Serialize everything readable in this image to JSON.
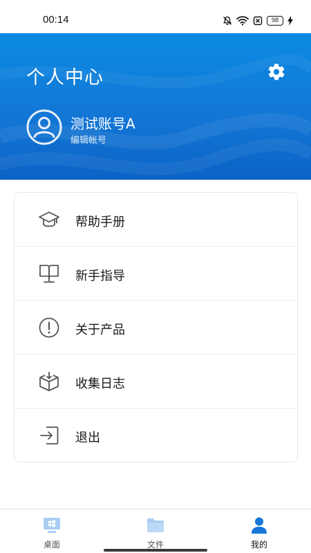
{
  "status_bar": {
    "time": "00:14",
    "battery": "98",
    "icons": [
      "mute-icon",
      "wifi-icon",
      "no-sim-icon",
      "battery-icon",
      "charging-icon"
    ]
  },
  "header": {
    "title": "个人中心",
    "settings_icon": "gear-icon",
    "account": {
      "avatar_icon": "user-avatar-icon",
      "name": "测试账号A",
      "edit_label": "编辑帐号"
    },
    "background_color": "#0b7ad8"
  },
  "menu": {
    "items": [
      {
        "label": "帮助手册",
        "icon": "graduation-cap-icon"
      },
      {
        "label": "新手指导",
        "icon": "open-book-monitor-icon"
      },
      {
        "label": "关于产品",
        "icon": "exclamation-circle-icon"
      },
      {
        "label": "收集日志",
        "icon": "box-download-icon"
      },
      {
        "label": "退出",
        "icon": "exit-icon"
      }
    ]
  },
  "bottom_nav": {
    "items": [
      {
        "label": "桌面",
        "icon": "desktop-icon",
        "active": false
      },
      {
        "label": "文件",
        "icon": "folder-icon",
        "active": false
      },
      {
        "label": "我的",
        "icon": "person-icon",
        "active": true
      }
    ],
    "active_color": "#1677d9",
    "inactive_color": "#a9cdf1"
  }
}
